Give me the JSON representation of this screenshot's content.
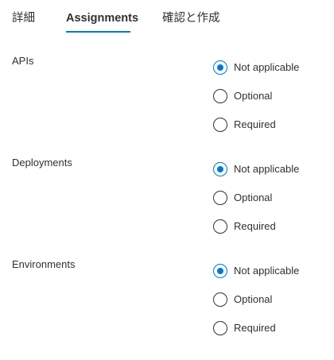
{
  "tabs": [
    {
      "label": "詳細",
      "active": false
    },
    {
      "label": "Assignments",
      "active": true
    },
    {
      "label": "確認と作成",
      "active": false
    }
  ],
  "accent_color": "#0078d4",
  "sections": [
    {
      "label": "APIs",
      "options": [
        {
          "label": "Not applicable",
          "checked": true
        },
        {
          "label": "Optional",
          "checked": false
        },
        {
          "label": "Required",
          "checked": false
        }
      ]
    },
    {
      "label": "Deployments",
      "options": [
        {
          "label": "Not applicable",
          "checked": true
        },
        {
          "label": "Optional",
          "checked": false
        },
        {
          "label": "Required",
          "checked": false
        }
      ]
    },
    {
      "label": "Environments",
      "options": [
        {
          "label": "Not applicable",
          "checked": true
        },
        {
          "label": "Optional",
          "checked": false
        },
        {
          "label": "Required",
          "checked": false
        }
      ]
    }
  ]
}
